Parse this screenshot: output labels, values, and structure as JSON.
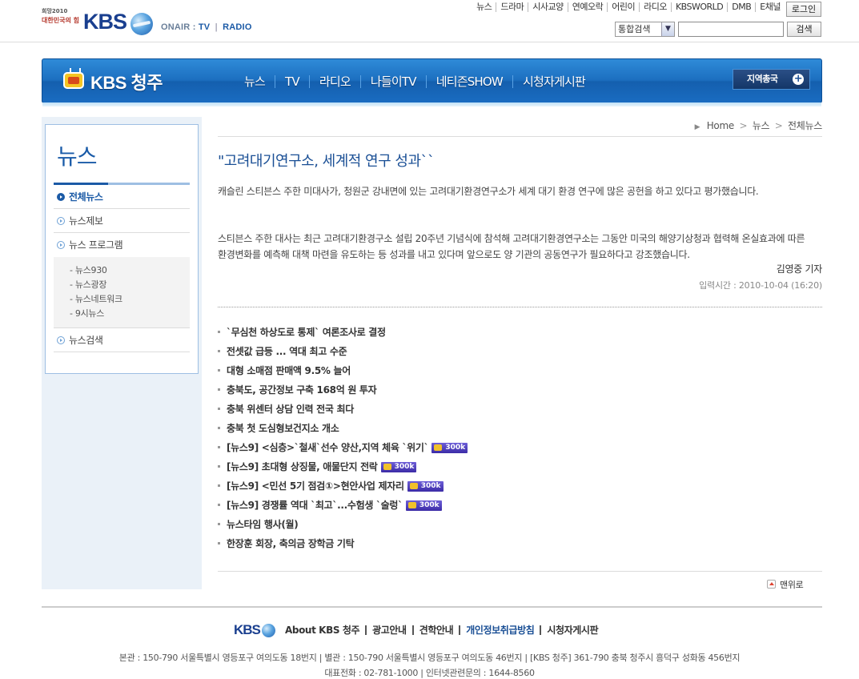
{
  "header": {
    "slogan_line1": "희망2010",
    "slogan_line2": "대한민국의 힘",
    "logo_text": "KBS",
    "onair_label": "ONAIR :",
    "onair_tv": "TV",
    "onair_radio": "RADIO",
    "gnb": [
      "뉴스",
      "드라마",
      "시사교양",
      "연예오락",
      "어린이",
      "라디오",
      "KBSWORLD",
      "DMB",
      "E채널"
    ],
    "login_label": "로그인",
    "search_scope": "통합검색",
    "search_value": "",
    "search_button": "검색"
  },
  "mainnav": {
    "brand": "KBS 청주",
    "menu": [
      "뉴스",
      "TV",
      "라디오",
      "나들이TV",
      "네티즌SHOW",
      "시청자게시판"
    ],
    "region_button": "지역총국"
  },
  "sidebar": {
    "title": "뉴스",
    "items": [
      {
        "label": "전체뉴스",
        "active": true
      },
      {
        "label": "뉴스제보",
        "active": false
      },
      {
        "label": "뉴스 프로그램",
        "active": false
      }
    ],
    "sub_items": [
      "- 뉴스930",
      "- 뉴스광장",
      "- 뉴스네트워크",
      "- 9시뉴스"
    ],
    "last_item": "뉴스검색"
  },
  "breadcrumb": {
    "home": "Home",
    "level1": "뉴스",
    "level2": "전체뉴스"
  },
  "article": {
    "title": "\"고려대기연구소, 세계적 연구 성과``",
    "paragraph1": "캐슬린 스티븐스 주한 미대사가, 청원군 강내면에 있는 고려대기환경연구소가 세계 대기 환경 연구에 많은 공헌을 하고 있다고 평가했습니다.",
    "paragraph2": "스티븐스 주한 대사는 최근 고려대기환경구소 설립 20주년 기념식에 참석해 고려대기환경연구소는 그동안 미국의 해양기상청과 협력해 온실효과에 따른 환경변화를 예측해 대책 마련을 유도하는 등 성과를 내고 있다며 앞으로도 양 기관의 공동연구가 필요하다고 강조했습니다.",
    "reporter": "김영중 기자",
    "datetime": "입력시간 : 2010-10-04 (16:20)"
  },
  "news_list": [
    {
      "title": "`무심천 하상도로 통제` 여론조사로 결정",
      "badge": ""
    },
    {
      "title": "전셋값 급등 ... 역대 최고 수준",
      "badge": ""
    },
    {
      "title": "대형 소매점 판매액 9.5% 늘어",
      "badge": ""
    },
    {
      "title": "충북도, 공간정보 구축 168억 원 투자",
      "badge": ""
    },
    {
      "title": "충북 위센터 상담 인력 전국 최다",
      "badge": ""
    },
    {
      "title": "충북 첫 도심형보건지소 개소",
      "badge": ""
    },
    {
      "title": "[뉴스9] <심층>`철새`선수 양산,지역 체육 `위기`",
      "badge": "300k"
    },
    {
      "title": "[뉴스9] 초대형 상징물, 애물단지 전락",
      "badge": "300k"
    },
    {
      "title": "[뉴스9] <민선 5기 점검①>현안사업 제자리",
      "badge": "300k"
    },
    {
      "title": "[뉴스9] 경쟁률 역대 `최고`...수험생 `술렁`",
      "badge": "300k"
    },
    {
      "title": "뉴스타임 행사(월)",
      "badge": ""
    },
    {
      "title": "한장훈 회장, 축의금 장학금 기탁",
      "badge": ""
    }
  ],
  "to_top": "맨위로",
  "footer": {
    "logo_text": "KBS",
    "links": [
      {
        "label": "About KBS 청주",
        "highlight": false
      },
      {
        "label": "광고안내",
        "highlight": false
      },
      {
        "label": "견학안내",
        "highlight": false
      },
      {
        "label": "개인정보취급방침",
        "highlight": true
      },
      {
        "label": "시청자게시판",
        "highlight": false
      }
    ],
    "address": "본관 : 150-790 서울특별시 영등포구 여의도동 18번지 | 별관 : 150-790 서울특별시 영등포구 여의도동 46번지 | [KBS 청주] 361-790 충북 청주시 흥덕구 성화동 456번지",
    "phone": "대표전화 : 02-781-1000 | 인터넷관련문의 : 1644-8560"
  }
}
